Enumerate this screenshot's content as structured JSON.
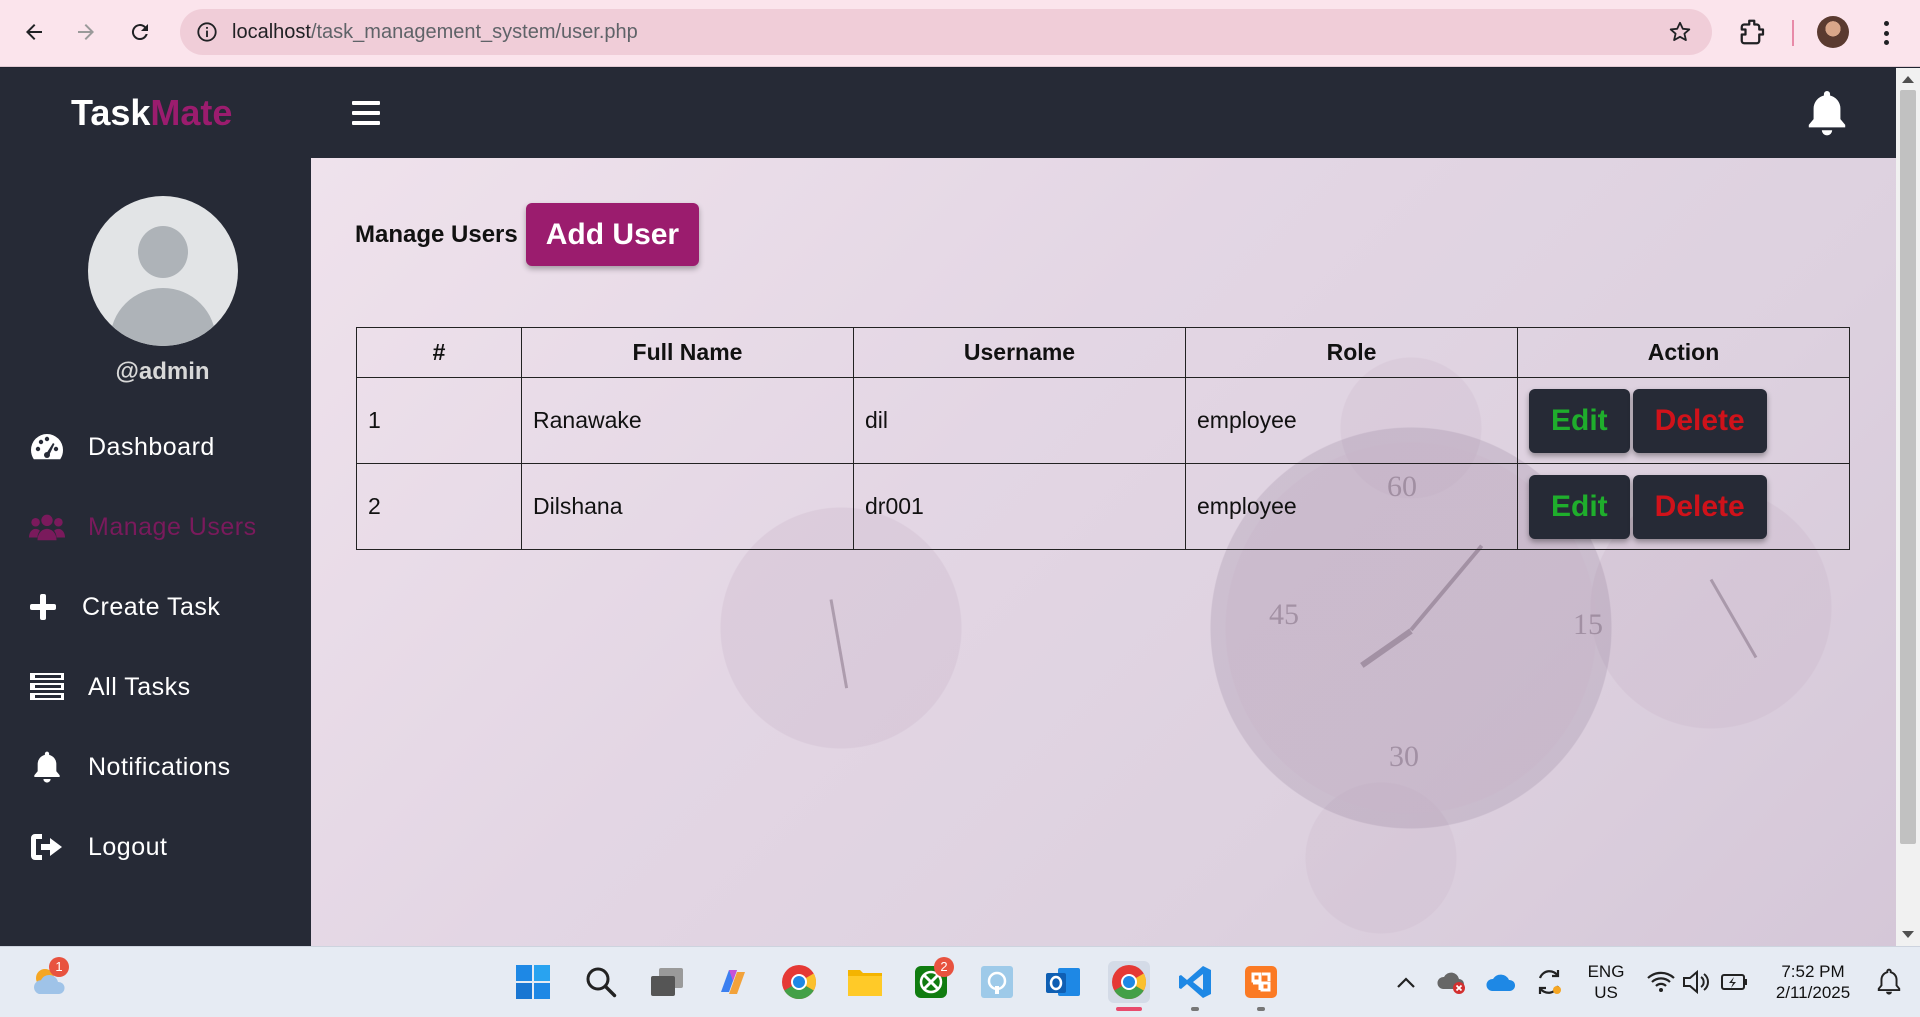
{
  "browser": {
    "url_host": "localhost",
    "url_path": "/task_management_system/user.php"
  },
  "header": {
    "brand_part1": "Task",
    "brand_part2": "Mate",
    "brand_accent": "#9b1c6e"
  },
  "sidebar": {
    "username": "@admin",
    "items": [
      {
        "label": "Dashboard",
        "icon": "dashboard-gauge-icon",
        "active": false
      },
      {
        "label": "Manage Users",
        "icon": "users-icon",
        "active": true
      },
      {
        "label": "Create Task",
        "icon": "plus-icon",
        "active": false
      },
      {
        "label": "All Tasks",
        "icon": "task-list-icon",
        "active": false
      },
      {
        "label": "Notifications",
        "icon": "bell-icon",
        "active": false
      },
      {
        "label": "Logout",
        "icon": "logout-icon",
        "active": false
      }
    ]
  },
  "main": {
    "title": "Manage Users",
    "add_button": "Add User",
    "table": {
      "headers": [
        "#",
        "Full Name",
        "Username",
        "Role",
        "Action"
      ],
      "rows": [
        {
          "num": "1",
          "full_name": "Ranawake",
          "username": "dil",
          "role": "employee"
        },
        {
          "num": "2",
          "full_name": "Dilshana",
          "username": "dr001",
          "role": "employee"
        }
      ],
      "edit_label": "Edit",
      "delete_label": "Delete"
    }
  },
  "taskbar": {
    "weather_badge": "1",
    "xbox_badge": "2",
    "lang_line1": "ENG",
    "lang_line2": "US",
    "time": "7:52 PM",
    "date": "2/11/2025"
  },
  "colors": {
    "sidebar_bg": "#262a36",
    "accent": "#9b1c6e",
    "edit": "#1fae2c",
    "delete": "#d0121a"
  }
}
